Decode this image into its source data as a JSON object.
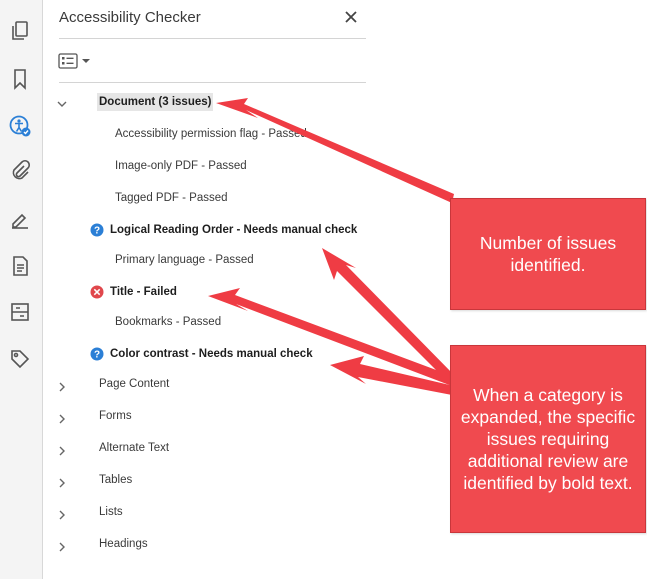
{
  "panel": {
    "title": "Accessibility Checker",
    "close_label": "✕"
  },
  "rail": {
    "icons": [
      "pages-icon",
      "bookmark-icon",
      "accessibility-icon",
      "attachment-icon",
      "signature-icon",
      "document-icon",
      "compare-icon",
      "tag-icon"
    ]
  },
  "tree": {
    "document": {
      "label": "Document (3 issues)",
      "expanded": true
    },
    "children": [
      {
        "label": "Accessibility permission flag - Passed",
        "status": "passed"
      },
      {
        "label": "Image-only PDF - Passed",
        "status": "passed"
      },
      {
        "label": "Tagged PDF - Passed",
        "status": "passed"
      },
      {
        "label": "Logical Reading Order - Needs manual check",
        "status": "manual"
      },
      {
        "label": "Primary language - Passed",
        "status": "passed"
      },
      {
        "label": "Title - Failed",
        "status": "failed"
      },
      {
        "label": "Bookmarks - Passed",
        "status": "passed"
      },
      {
        "label": "Color contrast - Needs manual check",
        "status": "manual"
      }
    ],
    "categories": [
      "Page Content",
      "Forms",
      "Alternate Text",
      "Tables",
      "Lists",
      "Headings"
    ]
  },
  "callouts": {
    "issues": "Number of issues identified.",
    "expanded": "When a category is expanded, the specific issues requiring additional review are identified by bold text."
  },
  "colors": {
    "callout": "#f04a4f",
    "arrow": "#ef3c44",
    "help_icon": "#2b7fd6",
    "failed_icon": "#e0474c"
  }
}
